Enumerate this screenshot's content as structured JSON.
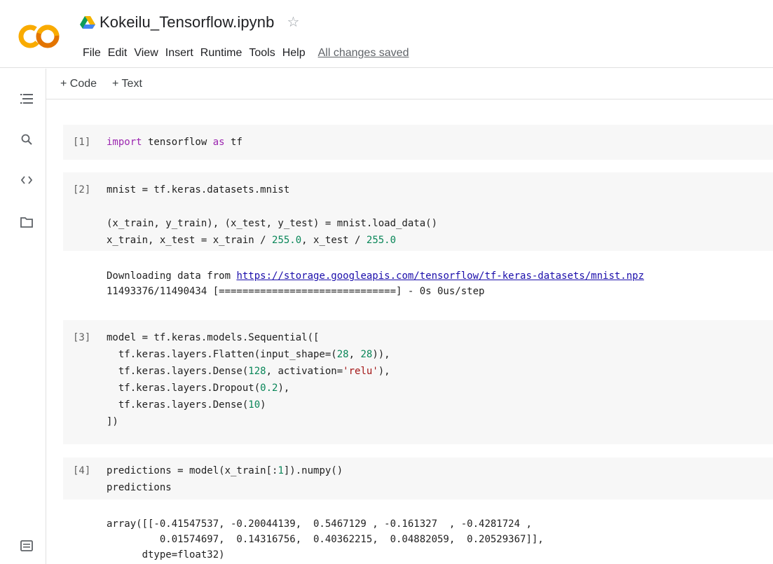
{
  "header": {
    "notebook_title": "Kokeilu_Tensorflow.ipynb",
    "star_icon": "star-outline-icon",
    "menu": [
      "File",
      "Edit",
      "View",
      "Insert",
      "Runtime",
      "Tools",
      "Help"
    ],
    "save_status": "All changes saved",
    "logo": {
      "text": "CO",
      "colors": [
        "#f9ab00",
        "#e37400"
      ]
    }
  },
  "rail": {
    "icons": [
      "table-of-contents-icon",
      "search-icon",
      "code-snippets-icon",
      "files-icon",
      "terminal-icon"
    ]
  },
  "toolbar": {
    "add_code": "+ Code",
    "add_text": "+ Text"
  },
  "cells": [
    {
      "number": "[1]",
      "code_parts": [
        [
          "kw",
          "import"
        ],
        [
          "t",
          " tensorflow "
        ],
        [
          "kw",
          "as"
        ],
        [
          "t",
          " tf"
        ]
      ]
    },
    {
      "number": "[2]",
      "code_lines": [
        "mnist = tf.keras.datasets.mnist",
        "",
        "(x_train, y_train), (x_test, y_test) = mnist.load_data()",
        "x_train, x_test = x_train / 255.0, x_test / 255.0"
      ],
      "output_prefix": "Downloading data from ",
      "output_link": "https://storage.googleapis.com/tensorflow/tf-keras-datasets/mnist.npz",
      "output_progress": "11493376/11490434 [==============================] - 0s 0us/step"
    },
    {
      "number": "[3]",
      "code_lines": [
        "model = tf.keras.models.Sequential([",
        "  tf.keras.layers.Flatten(input_shape=(28, 28)),",
        "  tf.keras.layers.Dense(128, activation='relu'),",
        "  tf.keras.layers.Dropout(0.2),",
        "  tf.keras.layers.Dense(10)",
        "])"
      ]
    },
    {
      "number": "[4]",
      "code_lines": [
        "predictions = model(x_train[:1]).numpy()",
        "predictions"
      ],
      "output_lines": [
        "array([[-0.41547537, -0.20044139,  0.5467129 , -0.161327  , -0.4281724 ,",
        "         0.01574697,  0.14316756,  0.40362215,  0.04882059,  0.20529367]],",
        "      dtype=float32)"
      ]
    }
  ]
}
